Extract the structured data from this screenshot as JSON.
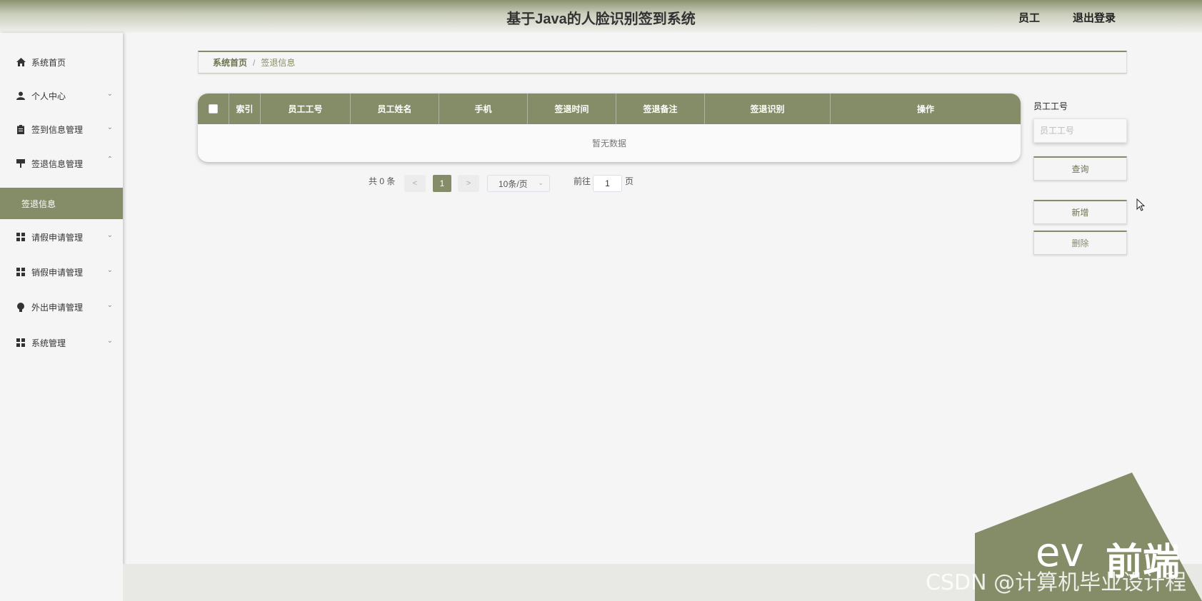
{
  "header": {
    "title": "基于Java的人脸识别签到系统",
    "user_label": "员工",
    "logout_label": "退出登录"
  },
  "sidebar": {
    "items": [
      {
        "label": "系统首页",
        "icon": "home-icon"
      },
      {
        "label": "个人中心",
        "icon": "user-icon"
      },
      {
        "label": "签到信息管理",
        "icon": "clipboard-icon"
      },
      {
        "label": "签退信息管理",
        "icon": "stamp-icon"
      },
      {
        "label": "请假申请管理",
        "icon": "grid-icon"
      },
      {
        "label": "销假申请管理",
        "icon": "grid-icon"
      },
      {
        "label": "外出申请管理",
        "icon": "bulb-icon"
      },
      {
        "label": "系统管理",
        "icon": "grid-icon"
      }
    ],
    "sub_active": "签退信息"
  },
  "breadcrumb": {
    "home": "系统首页",
    "separator": "/",
    "current": "签退信息"
  },
  "table": {
    "columns": [
      "索引",
      "员工工号",
      "员工姓名",
      "手机",
      "签退时间",
      "签退备注",
      "签退识别",
      "操作"
    ],
    "empty_text": "暂无数据"
  },
  "pagination": {
    "total_text": "共 0 条",
    "prev": "<",
    "current_page": "1",
    "next": ">",
    "page_size": "10条/页",
    "goto_label": "前往",
    "goto_value": "1",
    "page_suffix": "页"
  },
  "search": {
    "label": "员工工号",
    "placeholder": "员工工号",
    "query_label": "查询",
    "add_label": "新增",
    "delete_label": "删除"
  },
  "watermark": {
    "csdn": "CSDN @计算机毕业设计程",
    "brand": "前端",
    "ev": "ev"
  },
  "colors": {
    "accent": "#858d68",
    "header_top": "#8a9470",
    "background": "#f5f5f5"
  }
}
